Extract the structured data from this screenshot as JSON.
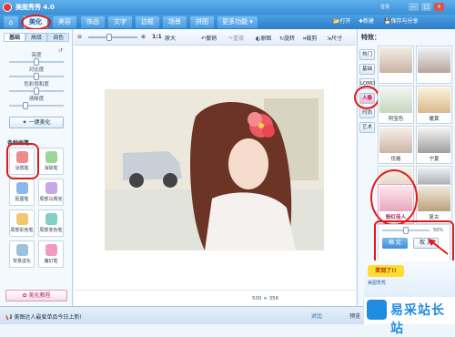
{
  "app": {
    "title": "美图秀秀 4.0",
    "account": "登录",
    "win_min": "—",
    "win_max": "□",
    "win_close": "×"
  },
  "menu": {
    "home_icon": "home-icon",
    "tabs": [
      "美化",
      "美容",
      "饰品",
      "文字",
      "边框",
      "场景",
      "拼图",
      "更多功能"
    ],
    "active_tab": "美化",
    "right_buttons": [
      "打开",
      "新建",
      "保存与分享"
    ]
  },
  "left": {
    "subtabs": [
      "基础",
      "高级",
      "调色"
    ],
    "sliders": [
      {
        "label": "亮度",
        "level": 0.5
      },
      {
        "label": "对比度",
        "level": 0.5
      },
      {
        "label": "色彩饱和度",
        "level": 0.5
      },
      {
        "label": "清晰度",
        "level": 0.3
      }
    ],
    "one_key_button": "一键美化",
    "brush_header": "各种画笔",
    "tools": [
      "涂鸦笔",
      "消除笔",
      "抠图笔",
      "局部马赛克",
      "局部彩色笔",
      "局部变色笔",
      "背景虚化",
      "魔幻笔"
    ],
    "tutorial_button": "美化教程"
  },
  "toolbar": {
    "zoom_ratio": "1:1",
    "zoom_fit": "原大",
    "items": [
      "撤销",
      "重做",
      "原图",
      "旋转",
      "裁剪",
      "尺寸"
    ]
  },
  "canvas": {
    "size_w": "500",
    "size_x": "×",
    "size_h": "356"
  },
  "right": {
    "header": "特效：",
    "categories": [
      "热门",
      "基础",
      "LOMO",
      "人像",
      "时尚",
      "艺术"
    ],
    "active_category": "人像",
    "effects": [
      "",
      "",
      "阿宝色",
      "暖黄",
      "优格",
      "宁夏",
      "日系",
      "漫画",
      "粉红佳人",
      "复古"
    ],
    "selected_effect": "粉红佳人",
    "slider_percent": "50%",
    "confirm": "确 定",
    "cancel": "取 消"
  },
  "ad": {
    "line1": "美图秀秀",
    "line2": "笑到了!!"
  },
  "footer": {
    "message": "美图达人最爱单品今日上新!",
    "btn1": "对比",
    "btn2": "预览"
  },
  "watermark": {
    "site": "易采站长站"
  },
  "colors": {
    "accent": "#3c8fd6",
    "highlight": "#e01a1a",
    "pink": "#f4bcd0"
  }
}
